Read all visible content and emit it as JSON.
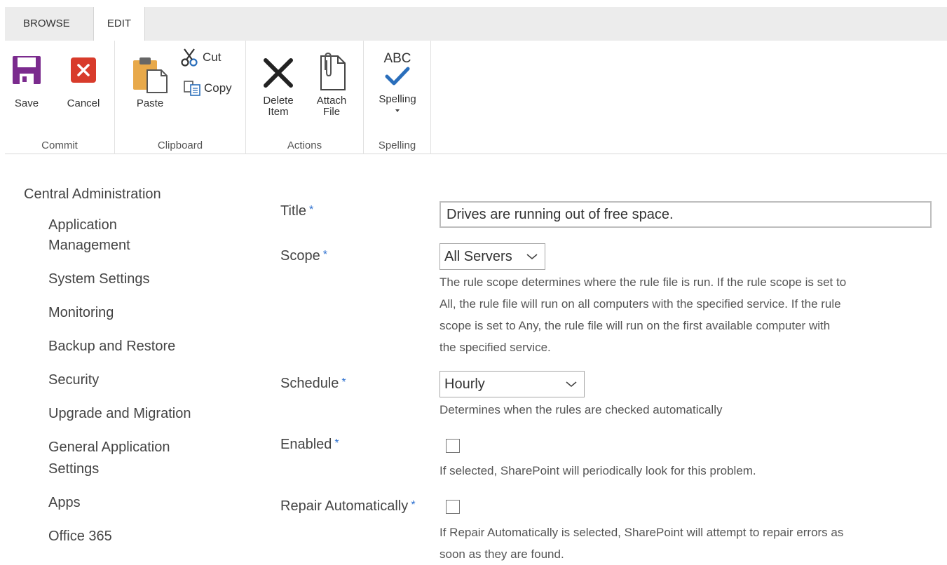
{
  "tabs": {
    "browse": "BROWSE",
    "edit": "EDIT"
  },
  "ribbon": {
    "commit": {
      "label": "Commit",
      "save": "Save",
      "cancel": "Cancel"
    },
    "clipboard": {
      "label": "Clipboard",
      "paste": "Paste",
      "cut": "Cut",
      "copy": "Copy"
    },
    "actions": {
      "label": "Actions",
      "delete_line1": "Delete",
      "delete_line2": "Item",
      "attach_line1": "Attach",
      "attach_line2": "File"
    },
    "spelling": {
      "label": "Spelling",
      "spelling": "Spelling",
      "abc": "ABC"
    }
  },
  "nav": {
    "root": "Central Administration",
    "items": [
      "Application",
      "Management",
      "System Settings",
      "Monitoring",
      "Backup and Restore",
      "Security",
      "Upgrade and Migration",
      "General Application",
      "Settings",
      "Apps",
      "Office 365"
    ]
  },
  "form": {
    "title": {
      "label": "Title",
      "value": "Drives are running out of free space."
    },
    "scope": {
      "label": "Scope",
      "value": "All Servers",
      "desc": [
        "The rule scope determines where the rule file is run. If the rule scope is set to",
        "All, the rule file will run on all computers with the specified service. If the rule",
        "scope is set to Any, the rule file will run on the first available computer with",
        "the specified service."
      ]
    },
    "schedule": {
      "label": "Schedule",
      "value": "Hourly",
      "desc": "Determines when the rules are checked automatically"
    },
    "enabled": {
      "label": "Enabled",
      "checked": false,
      "desc": "If selected, SharePoint will periodically look for this problem."
    },
    "repair": {
      "label": "Repair Automatically",
      "checked": false,
      "desc": [
        "If Repair Automatically is selected, SharePoint will attempt to repair errors as",
        "soon as they are found."
      ]
    },
    "required_marker": "*"
  },
  "colors": {
    "save_icon": "#7b2b8e",
    "cancel_icon": "#d83b2b",
    "check_icon": "#2a6ebb",
    "required": "#2b6fcf"
  }
}
